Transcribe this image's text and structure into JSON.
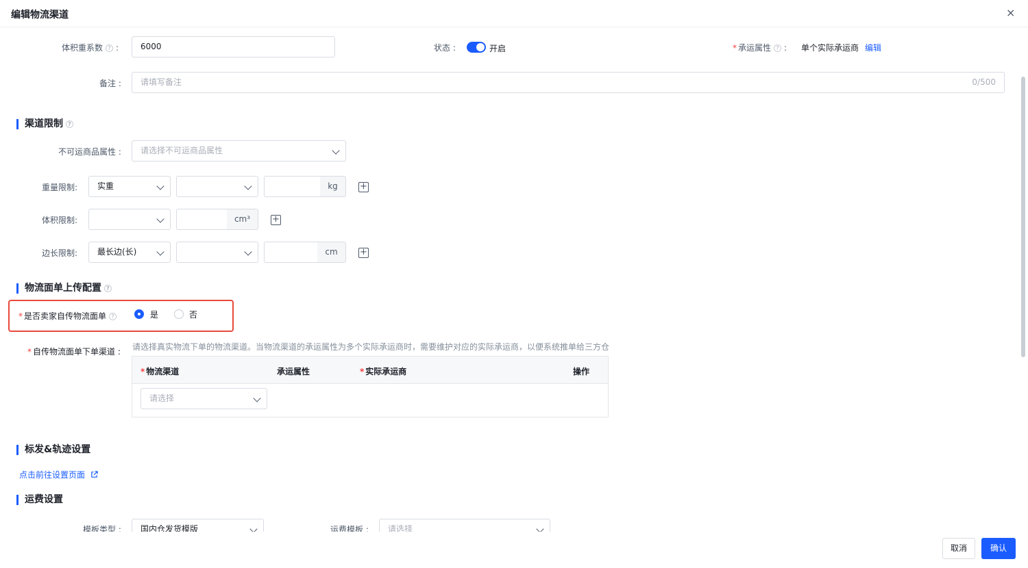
{
  "modal": {
    "title": "编辑物流渠道",
    "close_icon": "×"
  },
  "basic": {
    "volume_weight_label": "体积重系数",
    "volume_weight_value": "6000",
    "status_label": "状态",
    "status_text": "开启",
    "status_on": true,
    "carrier_attr_label": "承运属性",
    "carrier_attr_value": "单个实际承运商",
    "carrier_attr_edit": "编辑",
    "remark_label": "备注",
    "remark_placeholder": "请填写备注",
    "remark_count": "0/500"
  },
  "channel_limit": {
    "title": "渠道限制",
    "forbidden_label": "不可运商品属性",
    "forbidden_placeholder": "请选择不可运商品属性",
    "weight_label": "重量限制",
    "weight_type": "实重",
    "weight_unit": "kg",
    "volume_label": "体积限制",
    "volume_unit": "cm³",
    "edge_label": "边长限制",
    "edge_type": "最长边(长)",
    "edge_unit": "cm"
  },
  "waybill": {
    "title": "物流面单上传配置",
    "self_upload_label": "是否卖家自传物流面单",
    "yes": "是",
    "no": "否",
    "selected": "yes",
    "channel_label": "自传物流面单下单渠道",
    "hint": "请选择真实物流下单的物流渠道。当物流渠道的承运属性为多个实际承运商时，需要维护对应的实际承运商，以便系统推单给三方仓",
    "table": {
      "col_channel": "物流渠道",
      "col_attr": "承运属性",
      "col_carrier": "实际承运商",
      "col_action": "操作",
      "row_placeholder": "请选择"
    }
  },
  "tracking": {
    "title": "标发&轨迹设置",
    "link": "点击前往设置页面"
  },
  "freight": {
    "title": "运费设置",
    "template_type_label": "模板类型",
    "template_type_value": "国内仓发货模版",
    "template_label": "运费模板",
    "template_placeholder": "请选择"
  },
  "footer": {
    "cancel": "取消",
    "confirm": "确认"
  },
  "colors": {
    "primary": "#1a5cff",
    "highlight": "#e8493b"
  }
}
